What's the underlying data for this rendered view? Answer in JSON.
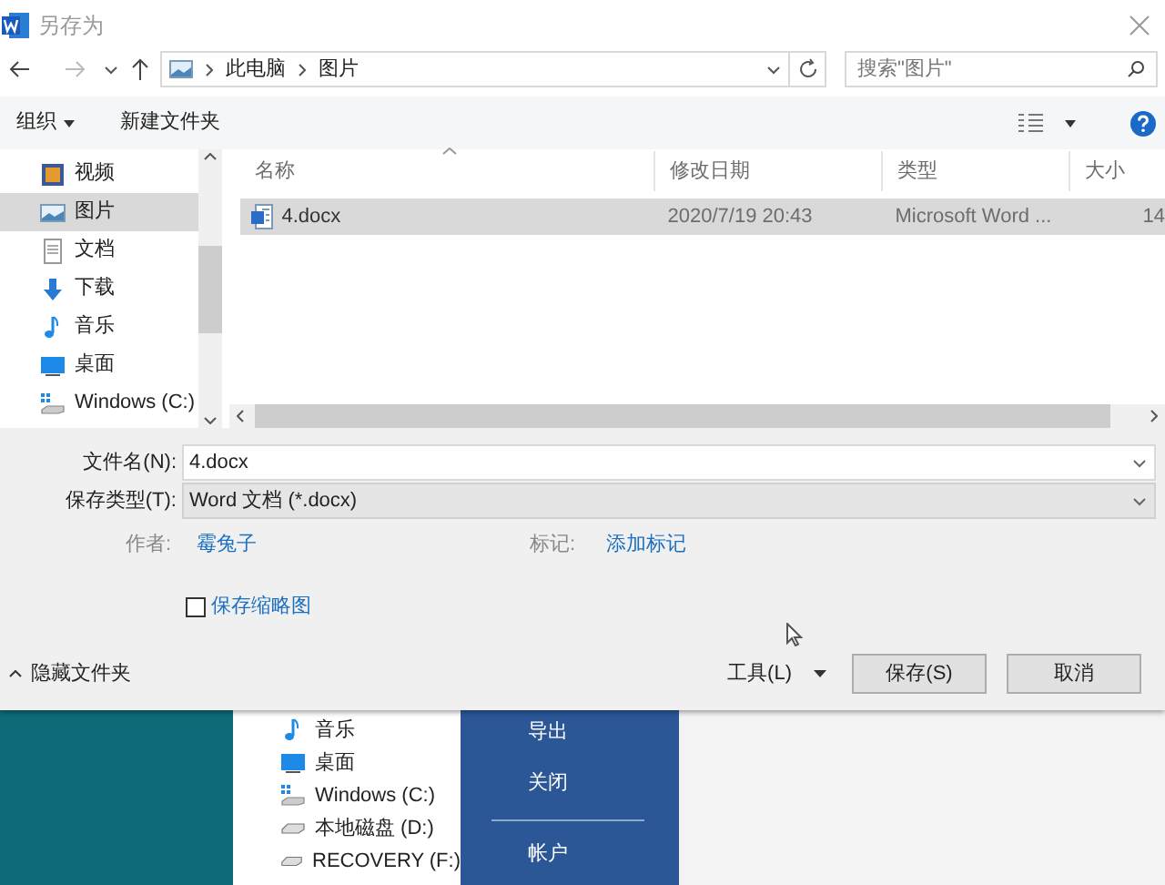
{
  "window": {
    "title": "另存为"
  },
  "address": {
    "path": [
      {
        "label": "此电脑"
      },
      {
        "label": "图片"
      }
    ],
    "search_placeholder": "搜索\"图片\""
  },
  "toolbar": {
    "organize": "组织",
    "new_folder": "新建文件夹"
  },
  "sidebar": {
    "items": [
      {
        "label": "视频",
        "kind": "video",
        "selected": false
      },
      {
        "label": "图片",
        "kind": "pictures",
        "selected": true
      },
      {
        "label": "文档",
        "kind": "documents",
        "selected": false
      },
      {
        "label": "下载",
        "kind": "downloads",
        "selected": false
      },
      {
        "label": "音乐",
        "kind": "music",
        "selected": false
      },
      {
        "label": "桌面",
        "kind": "desktop",
        "selected": false
      },
      {
        "label": "Windows (C:)",
        "kind": "drive",
        "selected": false
      }
    ]
  },
  "file_list": {
    "columns": [
      "名称",
      "修改日期",
      "类型",
      "大小"
    ],
    "rows": [
      {
        "cells": [
          "4.docx",
          "2020/7/19 20:43",
          "Microsoft Word ...",
          "14"
        ],
        "selected": true
      }
    ]
  },
  "form": {
    "filename_label": "文件名(N):",
    "filename": "4.docx",
    "type_label": "保存类型(T):",
    "type": "Word 文档 (*.docx)",
    "author_label": "作者:",
    "author": "霉兔子",
    "tags_label": "标记:",
    "tags": "添加标记",
    "thumbnail_label": "保存缩略图",
    "thumbnail_checked": false
  },
  "footer": {
    "hide_folders": "隐藏文件夹",
    "tools": "工具(L)",
    "save": "保存(S)",
    "cancel": "取消"
  },
  "background": {
    "nav_items": [
      {
        "label": "音乐",
        "kind": "music"
      },
      {
        "label": "桌面",
        "kind": "desktop"
      },
      {
        "label": "Windows (C:)",
        "kind": "drive"
      },
      {
        "label": "本地磁盘 (D:)",
        "kind": "disk"
      },
      {
        "label": "RECOVERY (F:)",
        "kind": "disk"
      }
    ],
    "menu_items": [
      {
        "label": "导出"
      },
      {
        "label": "关闭"
      },
      {
        "label": "帐户"
      }
    ]
  }
}
